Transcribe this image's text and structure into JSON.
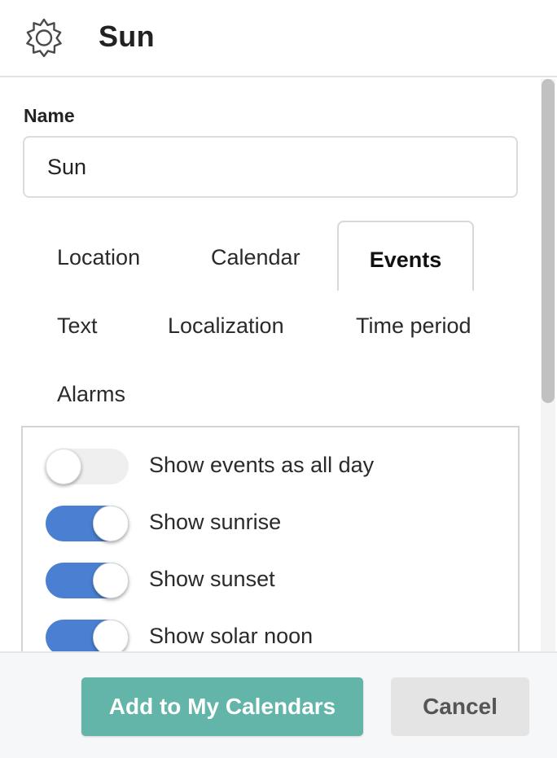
{
  "header": {
    "icon": "sun-icon",
    "title": "Sun"
  },
  "name_field": {
    "label": "Name",
    "value": "Sun"
  },
  "tabs": [
    {
      "label": "Location",
      "active": false
    },
    {
      "label": "Calendar",
      "active": false
    },
    {
      "label": "Events",
      "active": true
    },
    {
      "label": "Text",
      "active": false
    },
    {
      "label": "Localization",
      "active": false
    },
    {
      "label": "Time period",
      "active": false
    },
    {
      "label": "Alarms",
      "active": false
    }
  ],
  "options": [
    {
      "label": "Show events as all day",
      "on": false
    },
    {
      "label": "Show sunrise",
      "on": true
    },
    {
      "label": "Show sunset",
      "on": true
    },
    {
      "label": "Show solar noon",
      "on": true
    }
  ],
  "footer": {
    "add_label": "Add to My Calendars",
    "cancel_label": "Cancel"
  },
  "colors": {
    "toggle_on": "#4a7fd1",
    "add_button": "#62b5a8",
    "cancel_button": "#e4e4e4"
  }
}
